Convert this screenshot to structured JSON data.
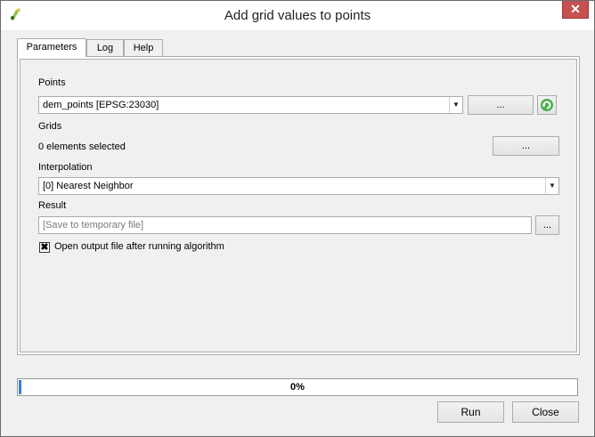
{
  "window": {
    "title": "Add grid values to points",
    "close": "✕"
  },
  "tabs": [
    {
      "label": "Parameters"
    },
    {
      "label": "Log"
    },
    {
      "label": "Help"
    }
  ],
  "params": {
    "points_label": "Points",
    "points_value": "dem_points [EPSG:23030]",
    "points_browse": "...",
    "grids_label": "Grids",
    "grids_value": "0 elements selected",
    "grids_browse": "...",
    "interp_label": "Interpolation",
    "interp_value": "[0] Nearest Neighbor",
    "result_label": "Result",
    "result_placeholder": "[Save to temporary file]",
    "result_browse": "...",
    "open_output_label": "Open output file after running algorithm",
    "open_output_checked": true
  },
  "progress": {
    "value": 0,
    "text": "0%"
  },
  "buttons": {
    "run": "Run",
    "close": "Close"
  }
}
